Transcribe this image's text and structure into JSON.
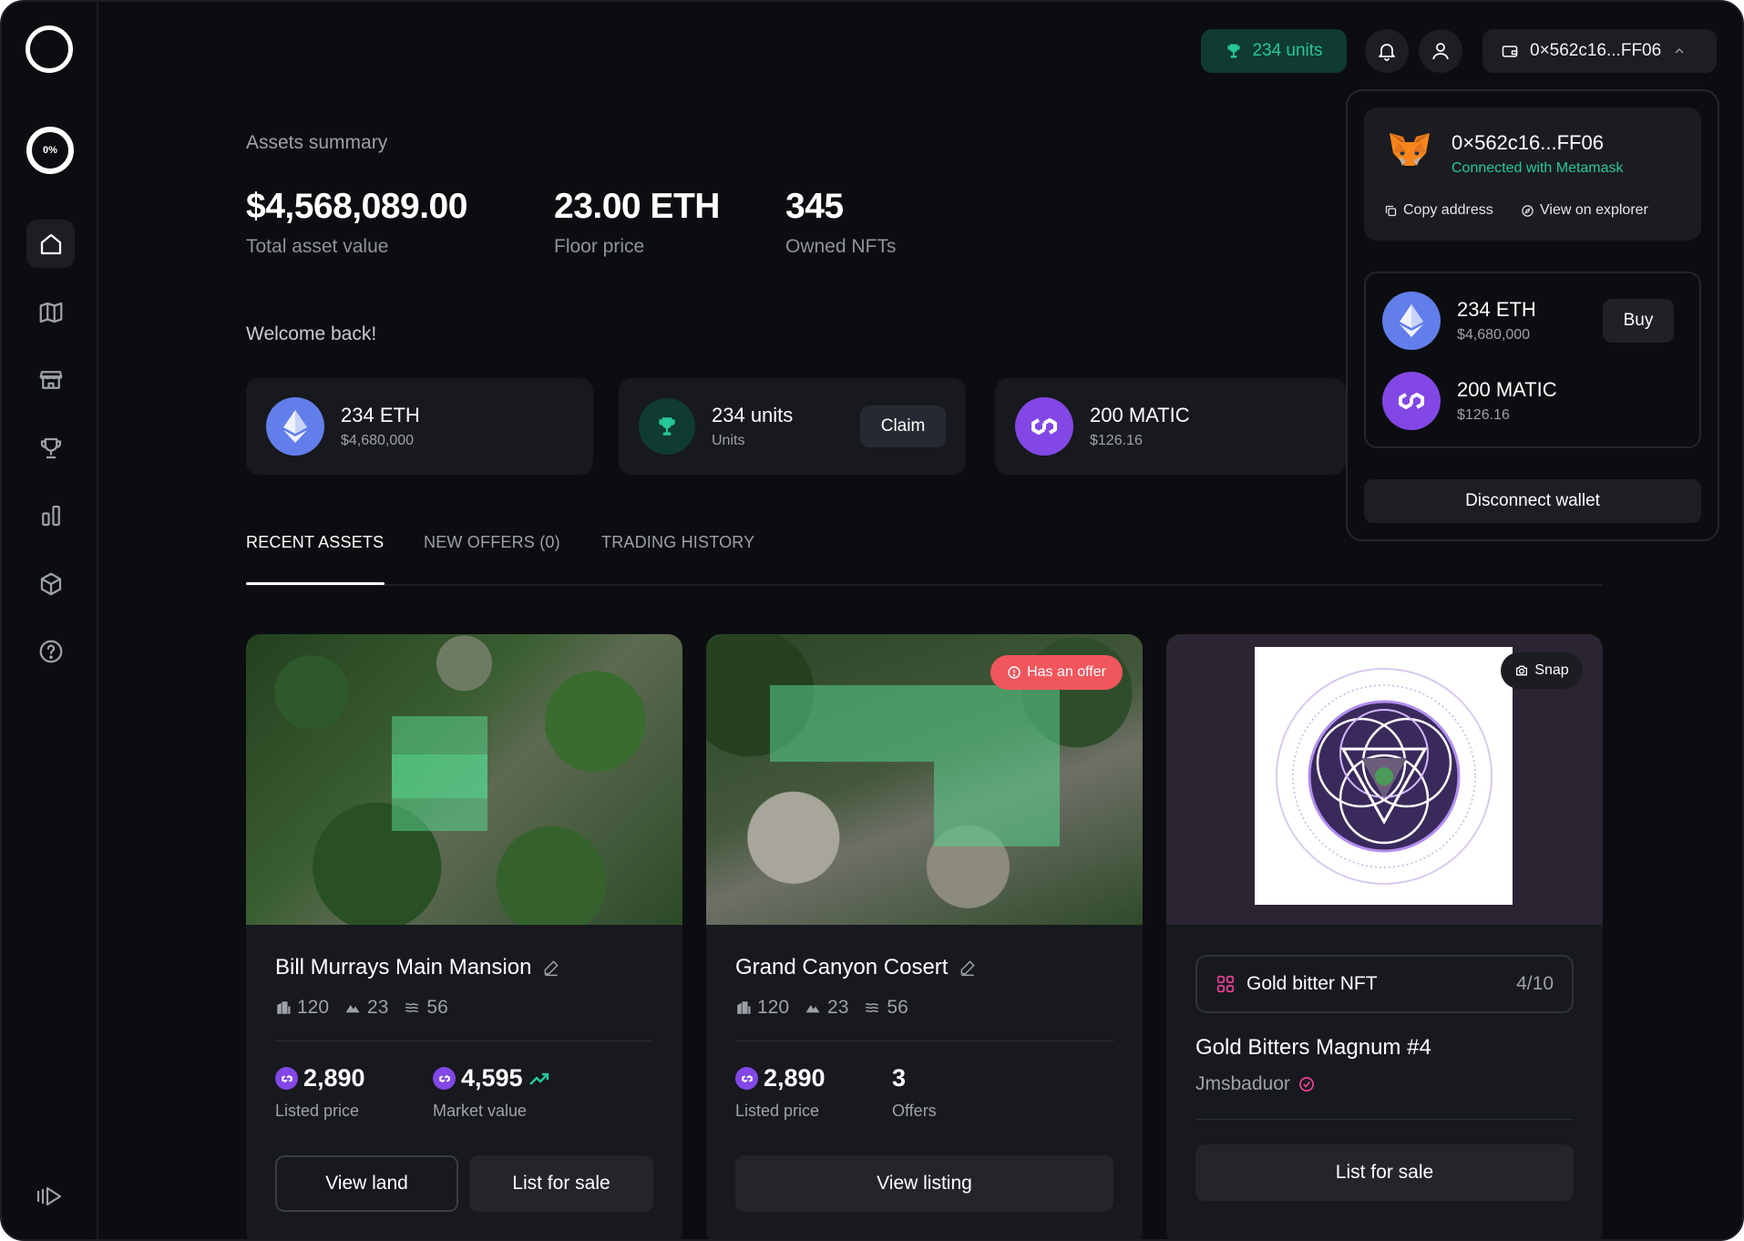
{
  "sidebar": {
    "progress_label": "0%",
    "items": [
      {
        "icon": "home-icon",
        "active": true
      },
      {
        "icon": "map-icon",
        "active": false
      },
      {
        "icon": "store-icon",
        "active": false
      },
      {
        "icon": "trophy-icon",
        "active": false
      },
      {
        "icon": "chart-icon",
        "active": false
      },
      {
        "icon": "cube-icon",
        "active": false
      },
      {
        "icon": "help-icon",
        "active": false
      }
    ]
  },
  "topbar": {
    "units_label": "234 units",
    "wallet_label": "0×562c16...FF06"
  },
  "summary": {
    "title": "Assets summary",
    "stats": [
      {
        "value": "$4,568,089.00",
        "label": "Total asset value"
      },
      {
        "value": "23.00 ETH",
        "label": "Floor price"
      },
      {
        "value": "345",
        "label": "Owned NFTs"
      }
    ]
  },
  "welcome": "Welcome back!",
  "tokens": [
    {
      "name": "234 ETH",
      "sub": "$4,680,000"
    },
    {
      "name": "234 units",
      "sub": "Units",
      "action": "Claim"
    },
    {
      "name": "200 MATIC",
      "sub": "$126.16"
    }
  ],
  "tabs": [
    {
      "label": "RECENT ASSETS",
      "active": true
    },
    {
      "label": "NEW OFFERS (0)",
      "active": false
    },
    {
      "label": "TRADING HISTORY",
      "active": false
    }
  ],
  "assets": [
    {
      "title": "Bill Murrays Main Mansion",
      "meta": [
        "120",
        "23",
        "56"
      ],
      "prices": [
        {
          "value": "2,890",
          "label": "Listed price"
        },
        {
          "value": "4,595",
          "label": "Market value"
        }
      ],
      "buttons": [
        "View land",
        "List for sale"
      ]
    },
    {
      "title": "Grand Canyon Cosert",
      "badge": "Has an offer",
      "meta": [
        "120",
        "23",
        "56"
      ],
      "prices": [
        {
          "value": "2,890",
          "label": "Listed price"
        },
        {
          "value": "3",
          "label": "Offers"
        }
      ],
      "buttons": [
        "View listing"
      ]
    },
    {
      "badge": "Snap",
      "collection": "Gold bitter NFT",
      "count": "4/10",
      "title": "Gold Bitters Magnum #4",
      "creator": "Jmsbaduor",
      "buttons": [
        "List for sale"
      ]
    }
  ],
  "wallet_dropdown": {
    "address": "0×562c16...FF06",
    "connected": "Connected with Metamask",
    "copy": "Copy address",
    "explorer": "View on explorer",
    "tokens": [
      {
        "name": "234 ETH",
        "sub": "$4,680,000",
        "action": "Buy"
      },
      {
        "name": "200 MATIC",
        "sub": "$126.16"
      }
    ],
    "disconnect": "Disconnect wallet"
  },
  "colors": {
    "background": "#0c0d10",
    "card": "#17191e",
    "accent_green": "#27c79b",
    "eth_blue": "#627eea",
    "matic_purple": "#8247e5",
    "offer_red": "#f0575d"
  }
}
